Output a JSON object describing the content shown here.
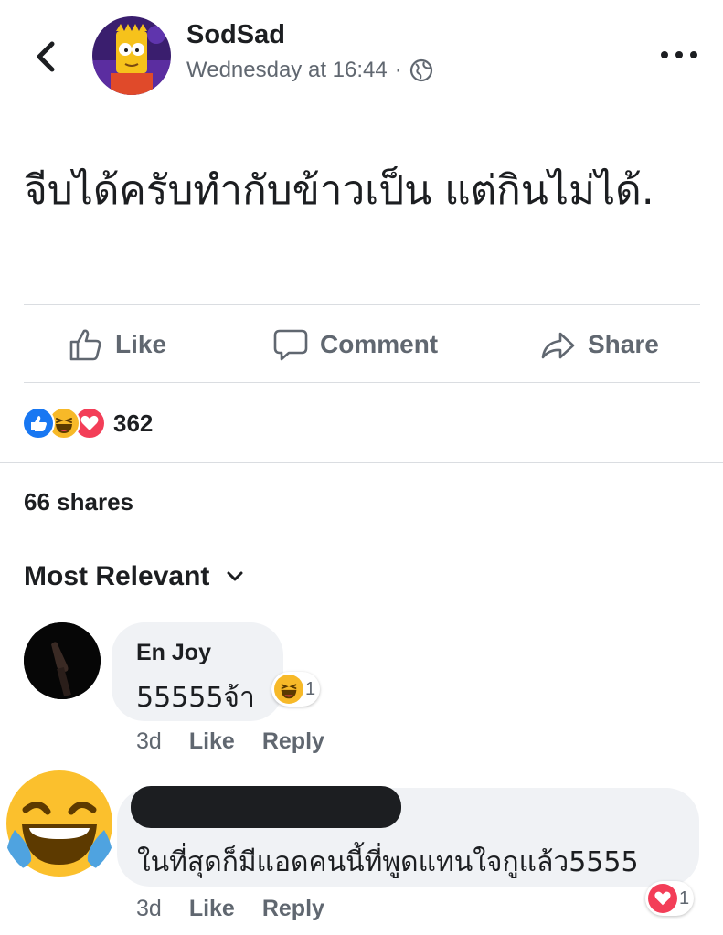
{
  "post": {
    "author": "SodSad",
    "timestamp": "Wednesday at 16:44",
    "meta_separator": "·",
    "privacy_icon": "globe-icon",
    "text": "จีบได้ครับทำกับข้าวเป็น แต่กินไม่ได้."
  },
  "actions": {
    "like": "Like",
    "comment": "Comment",
    "share": "Share"
  },
  "reactions": {
    "types": [
      "like",
      "haha",
      "love"
    ],
    "count": "362"
  },
  "shares": "66 shares",
  "sort": {
    "label": "Most Relevant"
  },
  "comments": [
    {
      "name": "En Joy",
      "text": "55555จ้า",
      "age": "3d",
      "like": "Like",
      "reply": "Reply",
      "reaction": "haha",
      "reaction_count": "1"
    },
    {
      "name": "",
      "text": "ในที่สุดก็มีแอดคนนี้ที่พูดแทนใจกูแล้ว5555",
      "age": "3d",
      "like": "Like",
      "reply": "Reply",
      "reaction": "love",
      "reaction_count": "1"
    }
  ],
  "colors": {
    "like_blue": "#1877f2",
    "love_red": "#f33e58",
    "haha_yellow": "#f7b928",
    "secondary_text": "#606770",
    "bubble_bg": "#f0f2f5"
  }
}
